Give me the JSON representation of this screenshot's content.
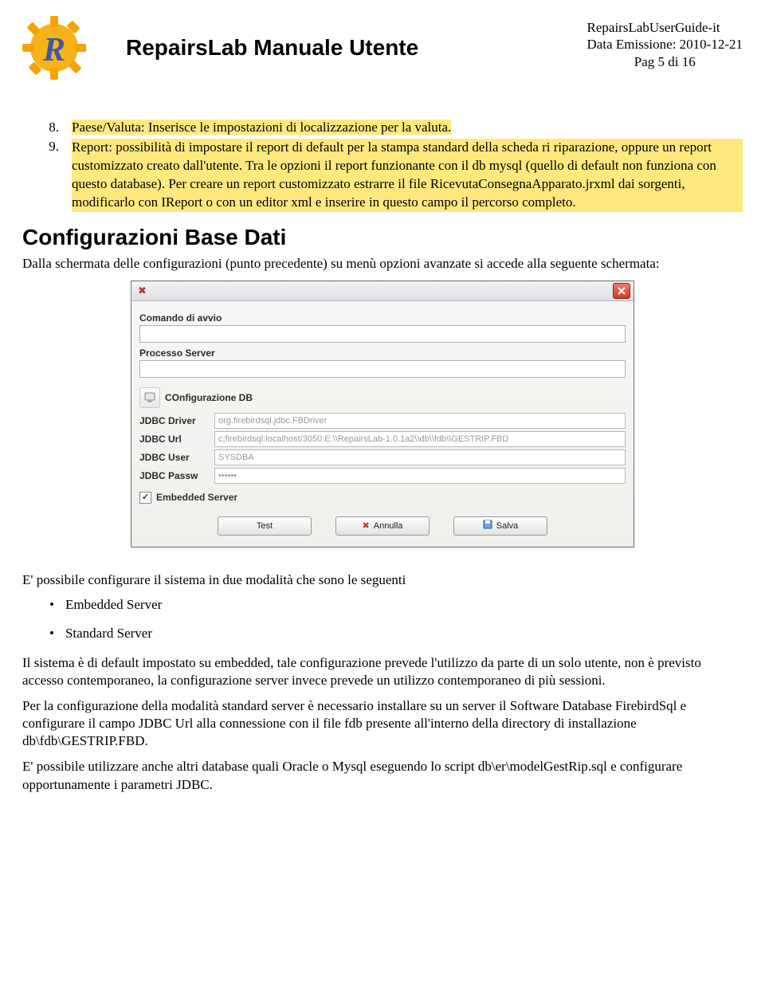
{
  "header": {
    "title": "RepairsLab Manuale Utente",
    "line1": "RepairsLabUserGuide-it",
    "line2": "Data Emissione: 2010-12-21",
    "line3": "Pag 5 di 16"
  },
  "list": {
    "n8": "8.",
    "t8": "Paese/Valuta: Inserisce le impostazioni di localizzazione per la valuta.",
    "n9": "9.",
    "t9a": "Report: possibilità di impostare il report di default per la stampa standard della scheda ri riparazione, oppure un report customizzato creato dall'utente. Tra le opzioni il report funzionante con il db mysql (quello di default non funziona con questo database). Per creare un report customizzato estrarre il file RicevutaConsegnaApparato.jrxml dai sorgenti, modificarlo con IReport o con un editor xml e inserire in questo campo il percorso completo."
  },
  "section_h": "Configurazioni Base Dati",
  "section_p": "Dalla schermata delle configurazioni (punto precedente) su menù opzioni avanzate si accede alla seguente schermata:",
  "dialog": {
    "comando_lbl": "Comando di avvio",
    "processo_lbl": "Processo Server",
    "config_lbl": "COnfigurazione DB",
    "jdbc_driver_lbl": "JDBC Driver",
    "jdbc_driver_val": "org.firebirdsql.jdbc.FBDriver",
    "jdbc_url_lbl": "JDBC Url",
    "jdbc_url_val": "c;firebirdsql:localhost/3050:E:\\\\RepairsLab-1.0.1a2\\\\db\\\\fdb\\\\GESTRIP.FBD",
    "jdbc_user_lbl": "JDBC User",
    "jdbc_user_val": "SYSDBA",
    "jdbc_pass_lbl": "JDBC Passw",
    "jdbc_pass_val": "••••••",
    "embedded_lbl": "Embedded Server",
    "btn_test": "Test",
    "btn_annulla": "Annulla",
    "btn_salva": "Salva"
  },
  "p_after1": "E' possibile configurare il sistema in due modalità che sono le seguenti",
  "bul1": "Embedded Server",
  "bul2": "Standard Server",
  "p_after2": "Il sistema è di default impostato su embedded, tale configurazione prevede l'utilizzo da parte di un solo utente, non è previsto accesso contemporaneo, la configurazione server invece prevede un utilizzo contemporaneo di più sessioni.",
  "p_after3": "Per la configurazione della modalità standard server è necessario installare su un server il Software Database FirebirdSql e configurare il campo JDBC Url alla connessione con il file fdb presente all'interno della directory di installazione db\\fdb\\GESTRIP.FBD.",
  "p_after4": "E' possibile utilizzare anche altri database quali Oracle o Mysql eseguendo lo script db\\er\\modelGestRip.sql e configurare opportunamente i parametri JDBC."
}
